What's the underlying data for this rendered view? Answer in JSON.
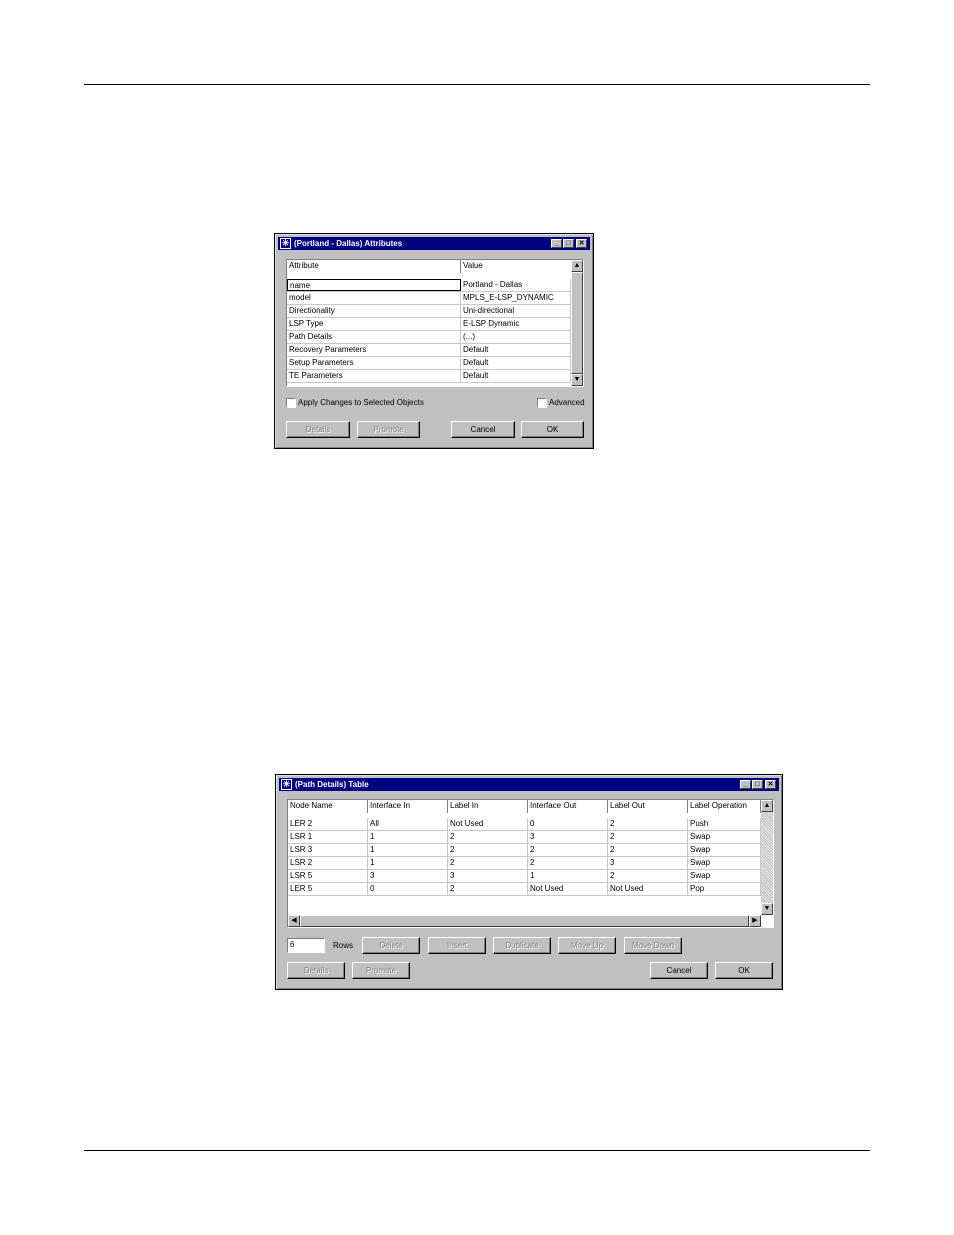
{
  "attr_dialog": {
    "title": "(Portland - Dallas) Attributes",
    "columns": [
      "Attribute",
      "Value"
    ],
    "rows": [
      [
        "name",
        "Portland - Dallas"
      ],
      [
        "model",
        "MPLS_E-LSP_DYNAMIC"
      ],
      [
        "Directionality",
        "Uni-directional"
      ],
      [
        "LSP Type",
        "E-LSP Dynamic"
      ],
      [
        "Path Details",
        "(...)"
      ],
      [
        "Recovery Parameters",
        "Default"
      ],
      [
        "Setup Parameters",
        "Default"
      ],
      [
        "TE Parameters",
        "Default"
      ]
    ],
    "apply_label": "Apply Changes to Selected Objects",
    "advanced_label": "Advanced",
    "buttons": {
      "details": "Details",
      "promote": "Promote",
      "cancel": "Cancel",
      "ok": "OK"
    }
  },
  "path_dialog": {
    "title": "(Path Details) Table",
    "columns": [
      "Node Name",
      "Interface In",
      "Label In",
      "Interface Out",
      "Label Out",
      "Label Operation"
    ],
    "rows": [
      [
        "LER 2",
        "All",
        "Not Used",
        "0",
        "2",
        "Push"
      ],
      [
        "LSR 1",
        "1",
        "2",
        "3",
        "2",
        "Swap"
      ],
      [
        "LSR 3",
        "1",
        "2",
        "2",
        "2",
        "Swap"
      ],
      [
        "LSR 2",
        "1",
        "2",
        "2",
        "3",
        "Swap"
      ],
      [
        "LSR 5",
        "3",
        "3",
        "1",
        "2",
        "Swap"
      ],
      [
        "LER 5",
        "0",
        "2",
        "Not Used",
        "Not Used",
        "Pop"
      ]
    ],
    "rows_count": "6",
    "rows_label": "Rows",
    "buttons": {
      "delete": "Delete",
      "insert": "Insert",
      "duplicate": "Duplicate",
      "move_up": "Move Up",
      "move_down": "Move Down",
      "details": "Details",
      "promote": "Promote",
      "cancel": "Cancel",
      "ok": "OK"
    }
  }
}
